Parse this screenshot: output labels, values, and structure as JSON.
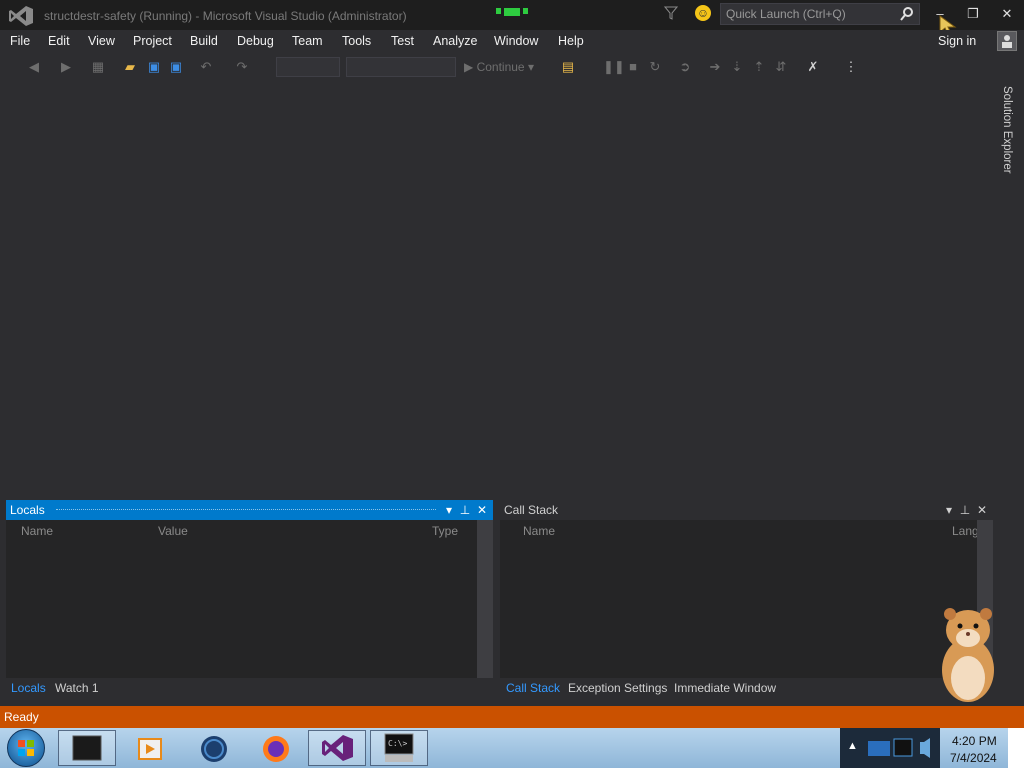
{
  "titlebar": {
    "title": "structdestr-safety (Running) - Microsoft Visual Studio (Administrator)",
    "quick_launch_placeholder": "Quick Launch (Ctrl+Q)",
    "sign_in": "Sign in",
    "minimize_glyph": "–",
    "restore_glyph": "❐",
    "close_glyph": "✕"
  },
  "menu": {
    "items": [
      "File",
      "Edit",
      "View",
      "Project",
      "Build",
      "Debug",
      "Team",
      "Tools",
      "Test",
      "Analyze",
      "Window",
      "Help"
    ]
  },
  "toolbar": {
    "continue_label": "Continue"
  },
  "side_tab": {
    "label": "Solution Explorer"
  },
  "locals_window": {
    "title": "Locals",
    "columns": [
      "Name",
      "Value",
      "Type"
    ],
    "tabs": [
      "Locals",
      "Watch 1"
    ]
  },
  "callstack_window": {
    "title": "Call Stack",
    "columns": [
      "Name",
      "Lang"
    ],
    "tabs": [
      "Call Stack",
      "Exception Settings",
      "Immediate Window"
    ]
  },
  "statusbar": {
    "text": "Ready"
  },
  "taskbar": {
    "time": "4:20 PM",
    "date": "7/4/2024"
  },
  "colors": {
    "accent": "#007acc",
    "status_debug": "#ca5100",
    "background": "#2d2d30",
    "vs_purple": "#68217a"
  }
}
